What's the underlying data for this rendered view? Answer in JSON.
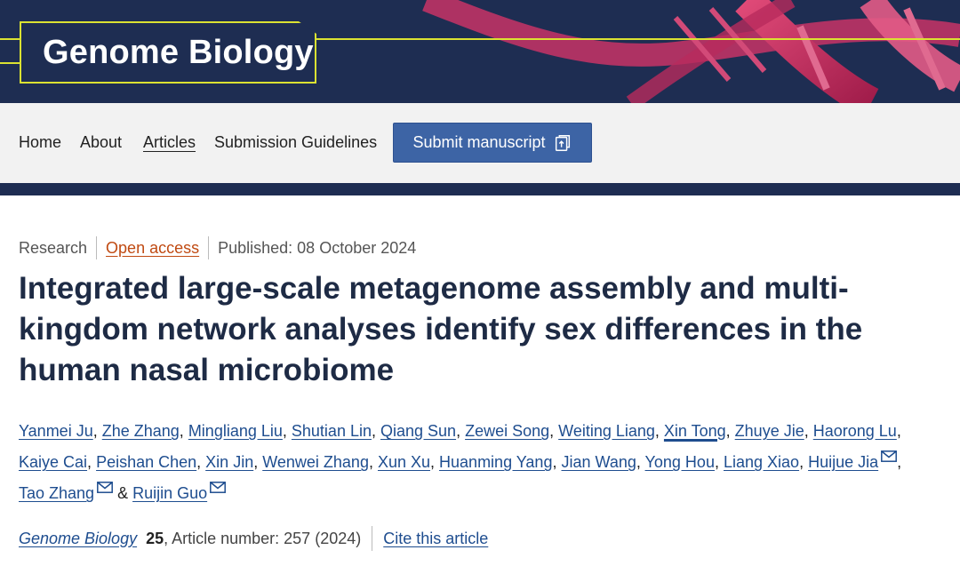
{
  "header": {
    "journal_name": "Genome Biology",
    "accent_color": "#dbe232",
    "background_color": "#1e2d52"
  },
  "nav": {
    "items": [
      {
        "label": "Home"
      },
      {
        "label": "About"
      },
      {
        "label": "Articles",
        "active": true
      },
      {
        "label": "Submission Guidelines"
      }
    ],
    "submit_label": "Submit manuscript",
    "submit_icon": "external-submit-icon"
  },
  "article": {
    "type": "Research",
    "access": "Open access",
    "published": "Published: 08 October 2024",
    "title": "Integrated large-scale metagenome assembly and multi-kingdom network analyses identify sex differences in the human nasal microbiome",
    "authors": [
      {
        "name": "Yanmei Ju"
      },
      {
        "name": "Zhe Zhang"
      },
      {
        "name": "Mingliang Liu"
      },
      {
        "name": "Shutian Lin"
      },
      {
        "name": "Qiang Sun"
      },
      {
        "name": "Zewei Song"
      },
      {
        "name": "Weiting Liang"
      },
      {
        "name": "Xin Tong",
        "highlighted": true
      },
      {
        "name": "Zhuye Jie"
      },
      {
        "name": "Haorong Lu"
      },
      {
        "name": "Kaiye Cai"
      },
      {
        "name": "Peishan Chen"
      },
      {
        "name": "Xin Jin"
      },
      {
        "name": "Wenwei Zhang"
      },
      {
        "name": "Xun Xu"
      },
      {
        "name": "Huanming Yang"
      },
      {
        "name": "Jian Wang"
      },
      {
        "name": "Yong Hou"
      },
      {
        "name": "Liang Xiao"
      },
      {
        "name": "Huijue Jia",
        "email_icon": true
      },
      {
        "name": "Tao Zhang",
        "email_icon": true
      },
      {
        "name": "Ruijin Guo",
        "email_icon": true
      }
    ],
    "citation": {
      "journal": "Genome Biology",
      "volume": "25",
      "article_number": ", Article number: 257 (2024)",
      "cite_label": "Cite this article"
    }
  }
}
